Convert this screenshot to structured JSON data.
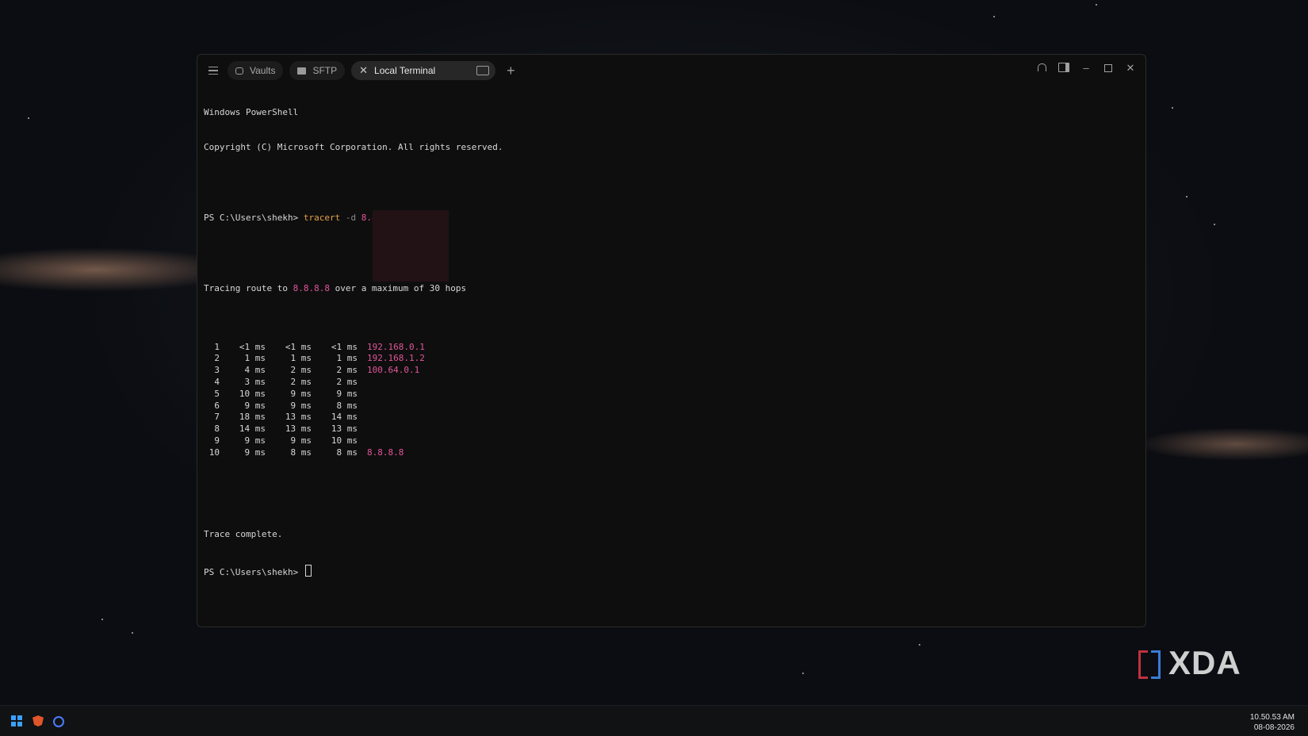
{
  "window": {
    "tabs": [
      {
        "label": "Vaults",
        "icon": "vault-icon"
      },
      {
        "label": "SFTP",
        "icon": "folder-icon"
      }
    ],
    "active_tab": {
      "label": "Local Terminal",
      "close_icon": "close-icon",
      "terminal_icon": "terminal-icon"
    },
    "new_tab_label": "+",
    "controls": [
      "bell-icon",
      "split-panel-icon",
      "minimize-icon",
      "maximize-icon",
      "close-icon"
    ]
  },
  "terminal": {
    "banner_line1": "Windows PowerShell",
    "banner_line2": "Copyright (C) Microsoft Corporation. All rights reserved.",
    "prompt": "PS C:\\Users\\shekh>",
    "command": "tracert",
    "flag": "-d",
    "target": "8.8.8.8",
    "tracing_prefix": "Tracing route to",
    "tracing_target": "8.8.8.8",
    "tracing_suffix": "over a maximum of 30 hops",
    "hops": [
      {
        "n": "1",
        "r1": "<1 ms",
        "r2": "<1 ms",
        "r3": "<1 ms",
        "host": "192.168.0.1"
      },
      {
        "n": "2",
        "r1": "1 ms",
        "r2": "1 ms",
        "r3": "1 ms",
        "host": "192.168.1.2"
      },
      {
        "n": "3",
        "r1": "4 ms",
        "r2": "2 ms",
        "r3": "2 ms",
        "host": "100.64.0.1"
      },
      {
        "n": "4",
        "r1": "3 ms",
        "r2": "2 ms",
        "r3": "2 ms",
        "host": ""
      },
      {
        "n": "5",
        "r1": "10 ms",
        "r2": "9 ms",
        "r3": "9 ms",
        "host": ""
      },
      {
        "n": "6",
        "r1": "9 ms",
        "r2": "9 ms",
        "r3": "8 ms",
        "host": ""
      },
      {
        "n": "7",
        "r1": "18 ms",
        "r2": "13 ms",
        "r3": "14 ms",
        "host": ""
      },
      {
        "n": "8",
        "r1": "14 ms",
        "r2": "13 ms",
        "r3": "13 ms",
        "host": ""
      },
      {
        "n": "9",
        "r1": "9 ms",
        "r2": "9 ms",
        "r3": "10 ms",
        "host": ""
      },
      {
        "n": "10",
        "r1": "9 ms",
        "r2": "8 ms",
        "r3": "8 ms",
        "host": "8.8.8.8"
      }
    ],
    "complete": "Trace complete.",
    "final_prompt": "PS C:\\Users\\shekh>"
  },
  "watermark": {
    "text": "XDA"
  },
  "taskbar": {
    "icons": [
      "windows-start-icon",
      "brave-browser-icon",
      "cortana-icon"
    ],
    "time": "10.50.53 AM",
    "date": "08-08-2026"
  },
  "colors": {
    "accent_ip": "#e0569a",
    "command": "#e6a24a",
    "background": "#0e0e0e"
  }
}
